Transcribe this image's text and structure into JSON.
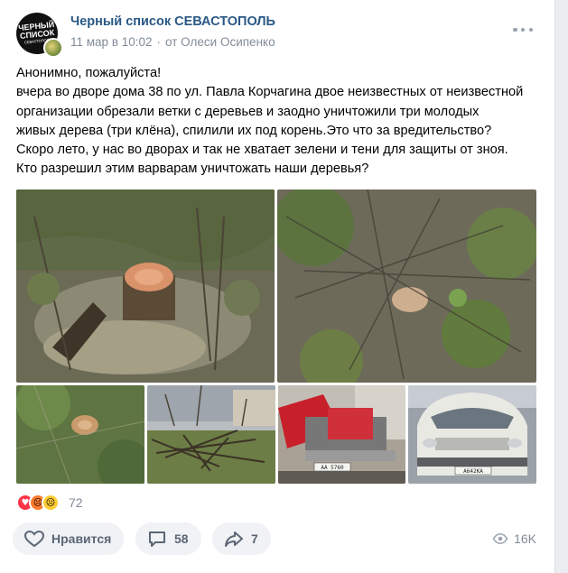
{
  "post": {
    "avatar_text": "ЧЕРНЫЙ СПИСОК",
    "avatar_sub": "СЕВАСТОПОЛЬ",
    "group_name": "Черный список СЕВАСТОПОЛЬ",
    "date": "11 мар в 10:02",
    "separator": "·",
    "author": "от Олеси Осипенко",
    "text_lines": [
      "Анонимно, пожалуйста!",
      "вчера во дворе дома 38 по ул. Павла Корчагина двое неизвестных от неизвестной",
      "организации обрезали ветки с деревьев и заодно уничтожили три молодых",
      "живых дерева (три клёна), спилили их под корень.Это что за вредительство?",
      "Скоро лето, у нас во дворах и так не хватает зелени и тени для защиты от зноя.",
      "Кто разрешил этим варварам уничтожать наши деревья?"
    ]
  },
  "photos": [
    {
      "icon": "tree-stump-photo"
    },
    {
      "icon": "tree-stump-grass-photo"
    },
    {
      "icon": "small-stump-photo"
    },
    {
      "icon": "cut-branches-photo"
    },
    {
      "icon": "red-trailer-photo",
      "plate": "АА 5760"
    },
    {
      "icon": "white-van-photo",
      "plate": "А642КА"
    }
  ],
  "reactions": {
    "count": "72",
    "emojis": [
      "heart-icon",
      "angry-face-icon",
      "sad-face-icon"
    ]
  },
  "actions": {
    "like_label": "Нравится",
    "comments_count": "58",
    "shares_count": "7",
    "views_count": "16K"
  },
  "colors": {
    "link": "#2a5885",
    "meta": "#818c99",
    "button_bg": "#f0f2f5"
  }
}
